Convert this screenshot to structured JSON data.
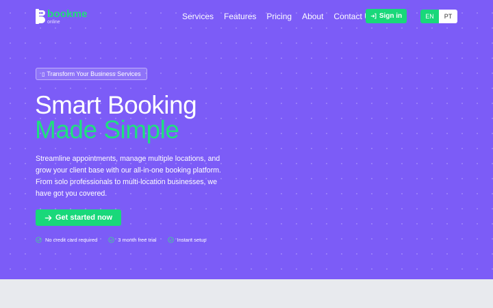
{
  "brand": {
    "name": "bookme",
    "sub": "online"
  },
  "nav": {
    "items": [
      {
        "label": "Services"
      },
      {
        "label": "Features"
      },
      {
        "label": "Pricing"
      },
      {
        "label": "About"
      },
      {
        "label": "Contact Us"
      }
    ],
    "signin_label": "Sign in",
    "languages": [
      {
        "code": "EN",
        "active": true
      },
      {
        "code": "PT",
        "active": false
      }
    ]
  },
  "hero": {
    "badge": {
      "icon": "box-glyph",
      "text": "Transform Your Business Services"
    },
    "title_line1": "Smart Booking",
    "title_line2": "Made Simple",
    "description": "Streamline appointments, manage multiple locations, and grow your client base with our all-in-one booking platform. From solo professionals to multi-location businesses, we have got you covered.",
    "cta_label": "Get started now",
    "checks": [
      {
        "label": "No credit card required",
        "icon": "check-circle-icon"
      },
      {
        "label": "3 month free trial",
        "icon": "check-circle-icon"
      },
      {
        "label": "Instant setup",
        "icon": "check-circle-icon"
      }
    ]
  },
  "colors": {
    "hero_bg": "#7c5cf7",
    "accent": "#19d87a",
    "section_bg": "#e8eaee"
  }
}
